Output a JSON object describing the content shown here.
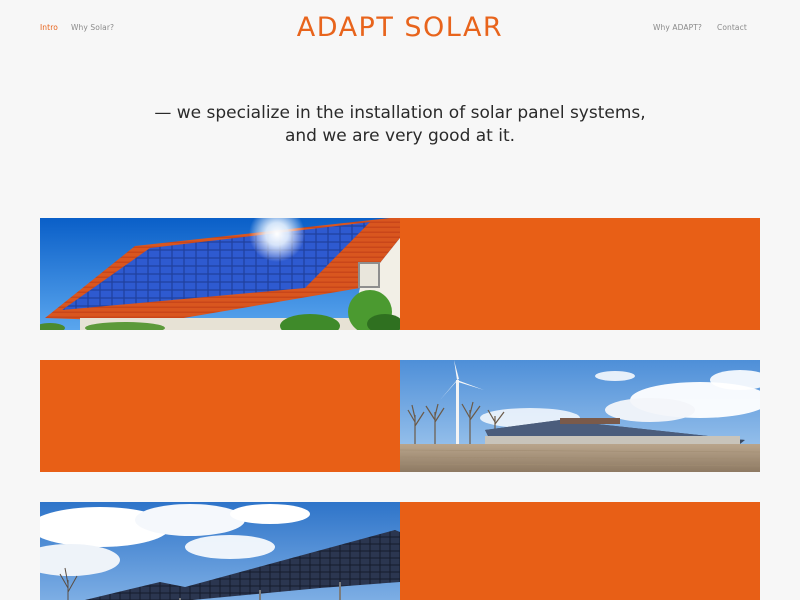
{
  "nav": {
    "left": [
      {
        "label": "Intro",
        "active": true
      },
      {
        "label": "Why Solar?",
        "active": false
      }
    ],
    "right": [
      {
        "label": "Why ADAPT?"
      },
      {
        "label": "Contact"
      }
    ]
  },
  "brand": {
    "name": "ADAPT SOLAR"
  },
  "tagline": {
    "line1": "— we specialize in the installation of solar panel systems,",
    "line2": "and we are very good at it."
  },
  "colors": {
    "accent": "#e8641c",
    "panel_orange": "#e85f16",
    "background": "#f7f7f7"
  },
  "images": [
    {
      "icon": "house-rooftop-solar-photo"
    },
    {
      "icon": "wind-turbine-solar-farm-photo"
    },
    {
      "icon": "solar-panel-array-sky-photo"
    }
  ]
}
